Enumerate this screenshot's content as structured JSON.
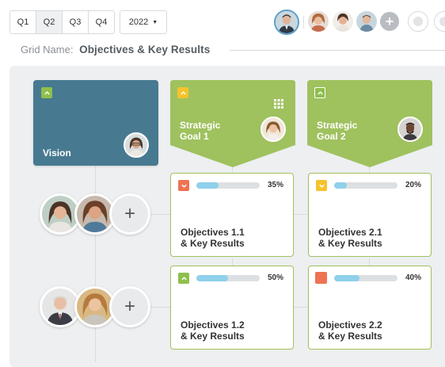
{
  "toolbar": {
    "quarters": [
      "Q1",
      "Q2",
      "Q3",
      "Q4"
    ],
    "active_quarter": "Q2",
    "year": "2022"
  },
  "grid": {
    "name_label": "Grid Name:",
    "name_value": "Objectives & Key Results"
  },
  "vision": {
    "label": "Vision"
  },
  "goals": [
    {
      "label_line1": "Strategic",
      "label_line2": "Goal 1"
    },
    {
      "label_line1": "Strategic",
      "label_line2": "Goal 2"
    }
  ],
  "objectives": [
    {
      "line1": "Objectives 1.1",
      "line2": "& Key Results",
      "progress_label": "35%",
      "progress": 0.35,
      "status": "red",
      "status_icon": "chevron-down-icon"
    },
    {
      "line1": "Objectives 2.1",
      "line2": "& Key Results",
      "progress_label": "20%",
      "progress": 0.2,
      "status": "yellow",
      "status_icon": "chevron-down-icon"
    },
    {
      "line1": "Objectives 1.2",
      "line2": "& Key Results",
      "progress_label": "50%",
      "progress": 0.5,
      "status": "green",
      "status_icon": "chevron-up-icon"
    },
    {
      "line1": "Objectives 2.2",
      "line2": "& Key Results",
      "progress_label": "40%",
      "progress": 0.4,
      "status": "red",
      "status_icon": "square-icon"
    }
  ],
  "colors": {
    "vision": "#477a90",
    "goal": "#9fc15e",
    "status_red": "#ee7352",
    "status_yellow": "#f5c32c",
    "status_green": "#8fbf4d",
    "progress_fill": "#8fd0ea"
  }
}
